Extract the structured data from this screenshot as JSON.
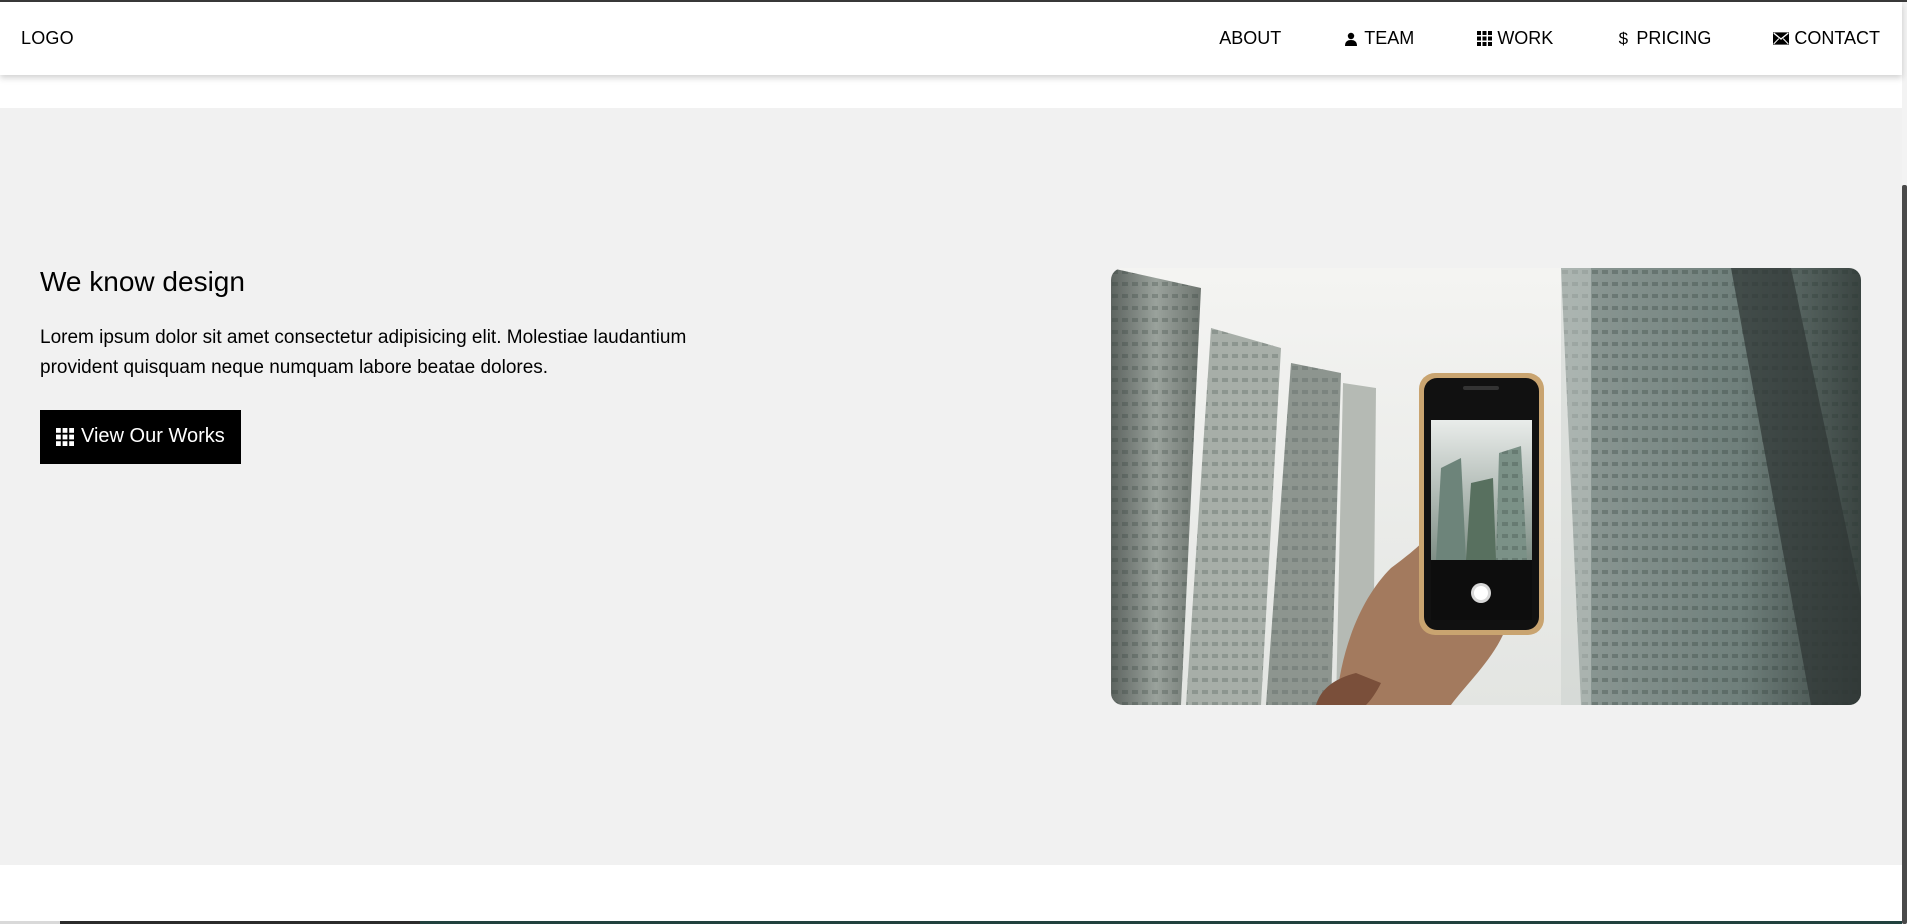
{
  "header": {
    "logo": "LOGO",
    "nav": [
      {
        "label": "ABOUT",
        "icon": ""
      },
      {
        "label": "TEAM",
        "icon": "user-icon"
      },
      {
        "label": "WORK",
        "icon": "grid-icon"
      },
      {
        "label": "PRICING",
        "icon": "dollar-icon"
      },
      {
        "label": "CONTACT",
        "icon": "envelope-icon"
      }
    ]
  },
  "hero": {
    "title": "We know design",
    "body": "Lorem ipsum dolor sit amet consectetur adipisicing elit. Molestiae laudantium provident quisquam neque numquam labore beatae dolores.",
    "cta_label": "View Our Works",
    "cta_icon": "grid-icon"
  },
  "colors": {
    "hero_background": "#f1f1f1",
    "button_background": "#000000",
    "button_text": "#ffffff",
    "header_background": "#ffffff"
  }
}
